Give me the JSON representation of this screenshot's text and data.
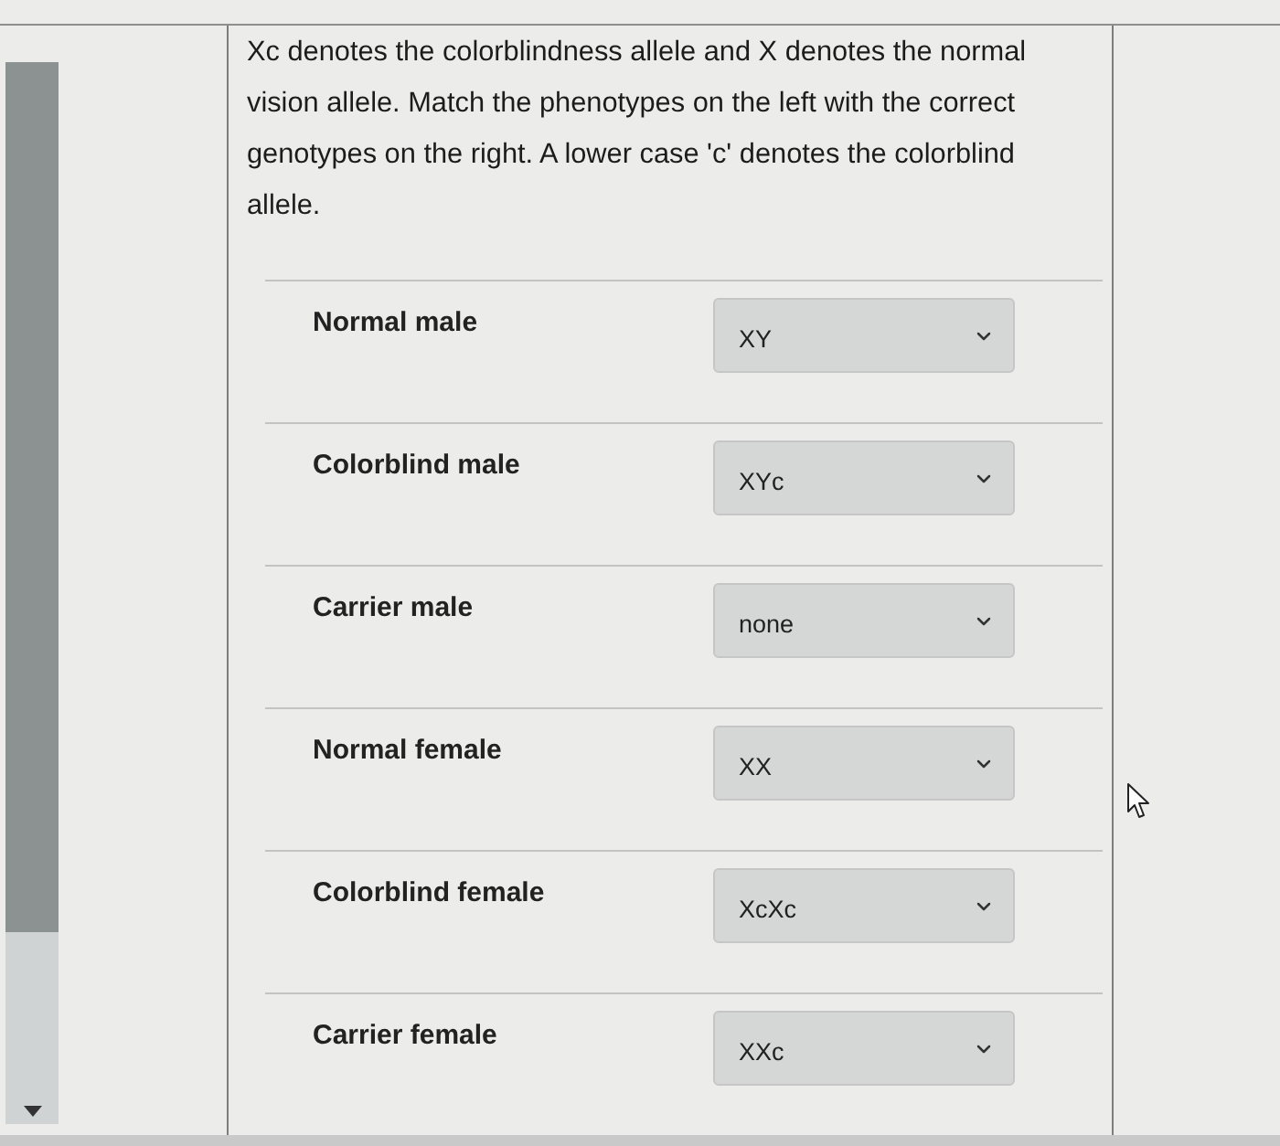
{
  "question": "Xc denotes the colorblindness allele and X denotes the normal vision allele. Match the phenotypes on the left with the correct genotypes on the right. A lower case 'c' denotes the colorblind allele.",
  "matches": [
    {
      "phenotype": "Normal male",
      "genotype": "XY"
    },
    {
      "phenotype": "Colorblind male",
      "genotype": "XYc"
    },
    {
      "phenotype": "Carrier male",
      "genotype": "none"
    },
    {
      "phenotype": "Normal female",
      "genotype": "XX"
    },
    {
      "phenotype": "Colorblind female",
      "genotype": "XcXc"
    },
    {
      "phenotype": "Carrier female",
      "genotype": "XXc"
    }
  ]
}
